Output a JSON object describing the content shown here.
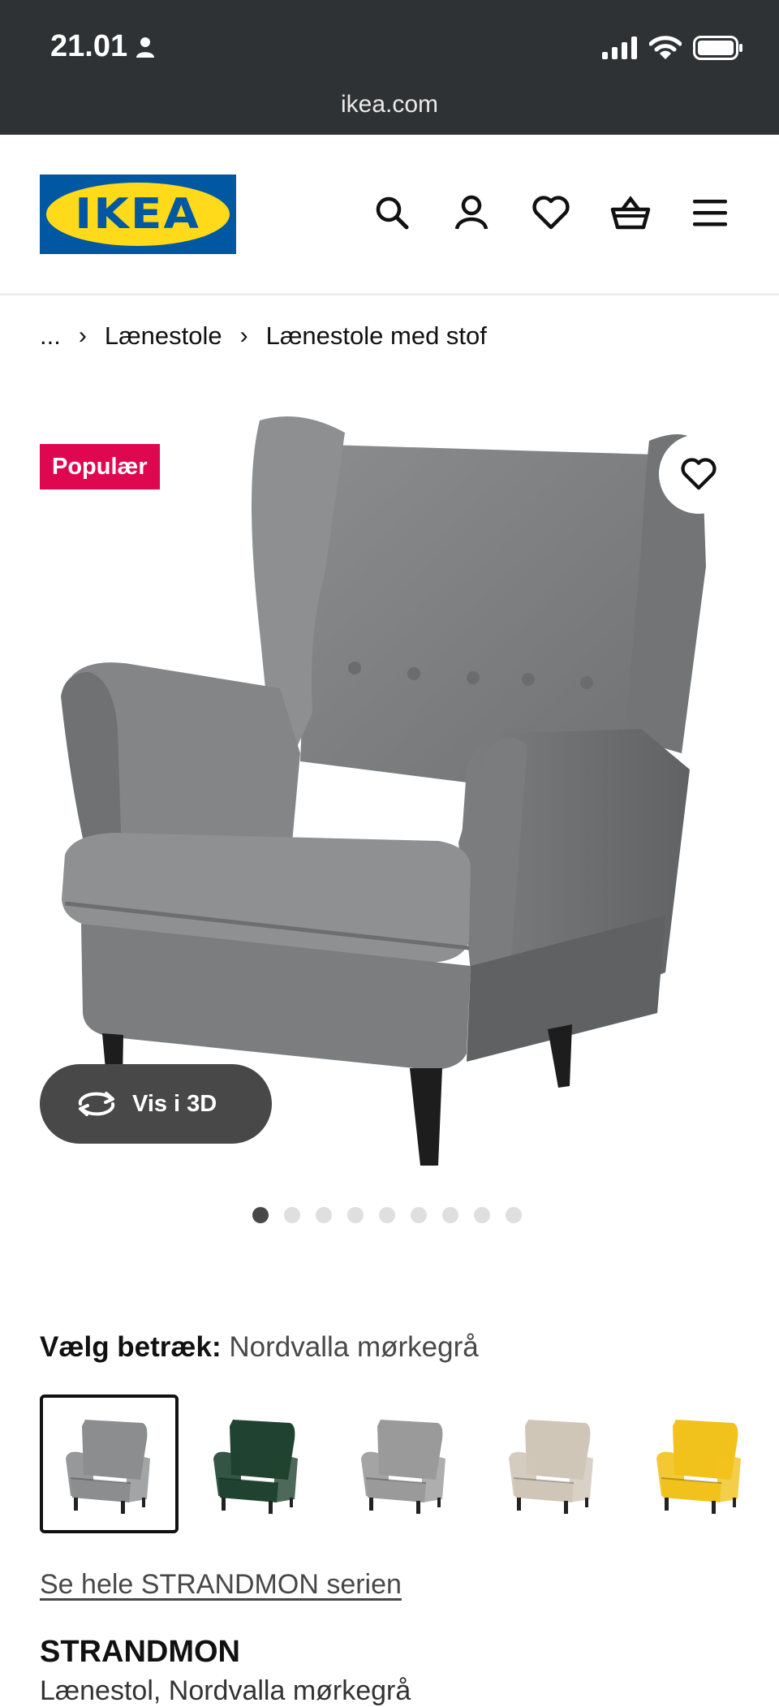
{
  "status_bar": {
    "time": "21.01",
    "url": "ikea.com"
  },
  "header": {
    "logo_text": "IKEA",
    "icons": [
      "search-icon",
      "account-icon",
      "heart-icon",
      "basket-icon",
      "menu-icon"
    ]
  },
  "breadcrumb": {
    "ellipsis": "...",
    "items": [
      "Lænestole",
      "Lænestole med stof"
    ]
  },
  "product": {
    "badge": "Populær",
    "view_3d": "Vis i 3D",
    "image_count": 9,
    "active_image": 1,
    "cover_label": "Vælg betræk:",
    "cover_value": "Nordvalla mørkegrå",
    "swatches": [
      {
        "color": "#8b8d8f",
        "selected": true
      },
      {
        "color": "#1f4330",
        "selected": false
      },
      {
        "color": "#9a9a9a",
        "selected": false
      },
      {
        "color": "#cfc6b8",
        "selected": false
      },
      {
        "color": "#f2c21c",
        "selected": false
      }
    ],
    "series_link": "Se hele STRANDMON serien",
    "name": "STRANDMON",
    "subtitle": "Lænestol, Nordvalla mørkegrå"
  },
  "colors": {
    "ikea_blue": "#0058a3",
    "ikea_yellow": "#ffda1a",
    "badge_red": "#e00751",
    "status_bg": "#2f3234"
  }
}
